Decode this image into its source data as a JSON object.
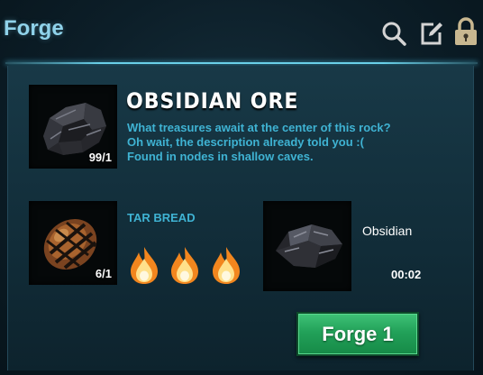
{
  "header": {
    "title": "Forge",
    "icons": [
      "search-icon",
      "edit-icon",
      "lock-icon"
    ]
  },
  "item": {
    "name": "OBSIDIAN ORE",
    "quantity": "99/1",
    "description": [
      "What treasures await at the center of this rock?",
      "Oh wait, the description already told you :(",
      "Found in nodes in shallow caves."
    ]
  },
  "fuel": {
    "label": "TAR BREAD",
    "quantity": "6/1",
    "flame_count": 3
  },
  "result": {
    "name": "Obsidian",
    "time": "00:02"
  },
  "action": {
    "forge_label": "Forge 1"
  },
  "colors": {
    "accent_cyan": "#3fb3d3",
    "title_blue": "#8fd2ea",
    "button_green": "#22a159"
  }
}
